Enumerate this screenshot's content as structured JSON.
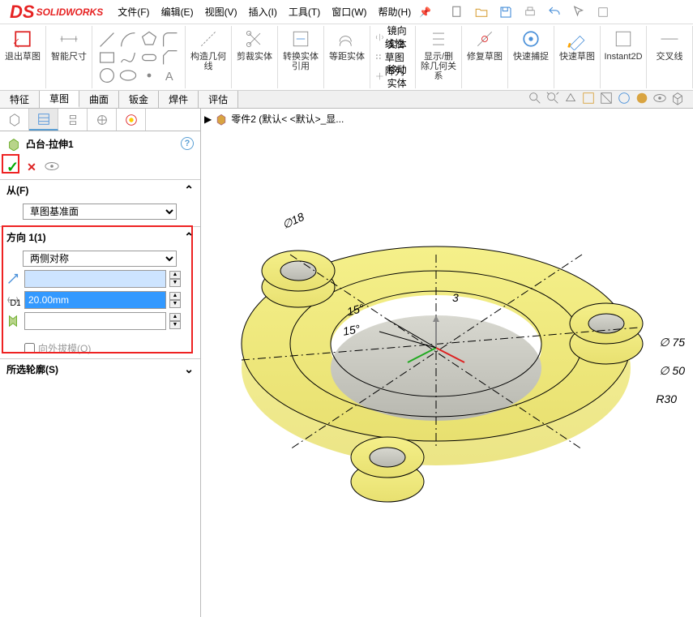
{
  "app_name": "SOLIDWORKS",
  "menu": {
    "file": "文件(F)",
    "edit": "编辑(E)",
    "view": "视图(V)",
    "insert": "插入(I)",
    "tools": "工具(T)",
    "window": "窗口(W)",
    "help": "帮助(H)"
  },
  "ribbon": {
    "exit_sketch": "退出草图",
    "smart_dim": "智能尺寸",
    "construct_geom": "构造几何线",
    "cut_entity": "剪裁实体",
    "convert_entity": "转换实体引用",
    "offset_entity": "等距实体",
    "mirror": "镜向实体",
    "linear_pattern": "线性草图阵列",
    "move": "移动实体",
    "show_del_rel": "显示/删除几何关系",
    "repair": "修复草图",
    "quick_snap": "快速捕捉",
    "quick_sketch": "快速草图",
    "instant2d": "Instant2D",
    "intersect": "交叉线"
  },
  "cmd_tabs": {
    "feature": "特征",
    "sketch": "草图",
    "surface": "曲面",
    "sheet": "钣金",
    "weld": "焊件",
    "evaluate": "评估"
  },
  "breadcrumb_doc": "零件2  (默认< <默认>_显...",
  "feature": {
    "title": "凸台-拉伸1",
    "from_label": "从(F)",
    "from_value": "草图基准面",
    "dir_label": "方向 1(1)",
    "dir_type": "两侧对称",
    "dir_rev_val": "",
    "depth_val": "20.00mm",
    "draft_val": "",
    "draft_out": "向外拔模(O)",
    "sel_contour": "所选轮廓(S)"
  },
  "dims": {
    "d75": "∅ 75",
    "d50": "∅ 50",
    "r30": "R30",
    "d18": "∅18",
    "a15a": "15°",
    "a15b": "15°",
    "three": "3"
  }
}
